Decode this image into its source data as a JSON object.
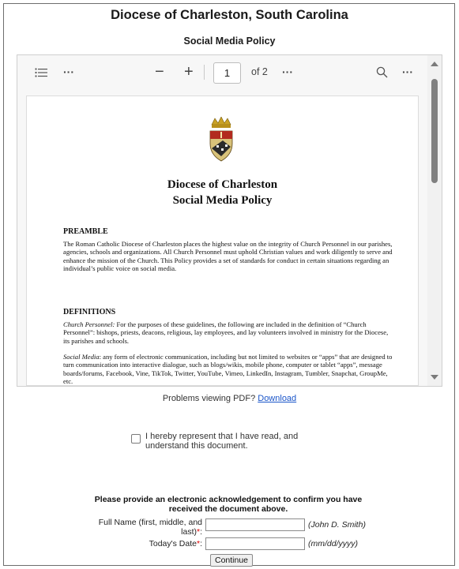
{
  "header": {
    "title": "Diocese of Charleston, South Carolina",
    "subtitle": "Social Media Policy"
  },
  "viewer": {
    "toolbar": {
      "outline_icon": "list-icon",
      "more_left": "···",
      "zoom_out": "−",
      "zoom_in": "+",
      "page_value": "1",
      "page_total": "of 2",
      "more_mid": "···",
      "search_icon": "magnifier-icon",
      "more_right": "···"
    },
    "document": {
      "heading_line1": "Diocese of Charleston",
      "heading_line2": "Social Media Policy",
      "preamble_heading": "PREAMBLE",
      "preamble_text": "The Roman Catholic Diocese of Charleston places the highest value on the integrity of Church Personnel in our parishes, agencies, schools and organizations. All Church Personnel must uphold Christian values and work diligently to serve and enhance the mission of the Church. This Policy provides a set of standards for conduct in certain situations regarding an individual’s public voice on social media.",
      "definitions_heading": "DEFINITIONS",
      "def1_term": "Church Personnel:",
      "def1_text": " For the purposes of these guidelines, the following are included in the definition of “Church Personnel”: bishops, priests, deacons, religious, lay employees, and lay volunteers involved in ministry for the Diocese, its parishes and  schools.",
      "def2_term": "Social Media",
      "def2_text": ": any form of electronic communication, including but not limited to websites or “apps” that are designed to turn communication into interactive dialogue, such as blogs/wikis, mobile phone, computer or tablet “apps”, message boards/forums, Facebook, Vine, TikTok, Twitter, YouTube, Vimeo, LinkedIn, Instagram, Tumbler, Snapchat, GroupMe, etc."
    }
  },
  "problems": {
    "text": "Problems viewing PDF? ",
    "link": "Download"
  },
  "acknowledge": {
    "checkbox_label": "I hereby represent that I have read, and understand this document."
  },
  "form": {
    "instructions": "Please provide an electronic acknowledgement to confirm you have received the document above.",
    "name_label": "Full Name (first, middle, and last)",
    "name_required": "*",
    "name_colon": ":",
    "name_value": "",
    "name_hint": "(John D. Smith)",
    "date_label": "Today's Date",
    "date_required": "*",
    "date_colon": ":",
    "date_value": "",
    "date_hint": "(mm/dd/yyyy)",
    "continue_label": "Continue"
  },
  "colors": {
    "link": "#1a55c9",
    "required": "#dd0000",
    "scroll_thumb": "#808080"
  }
}
